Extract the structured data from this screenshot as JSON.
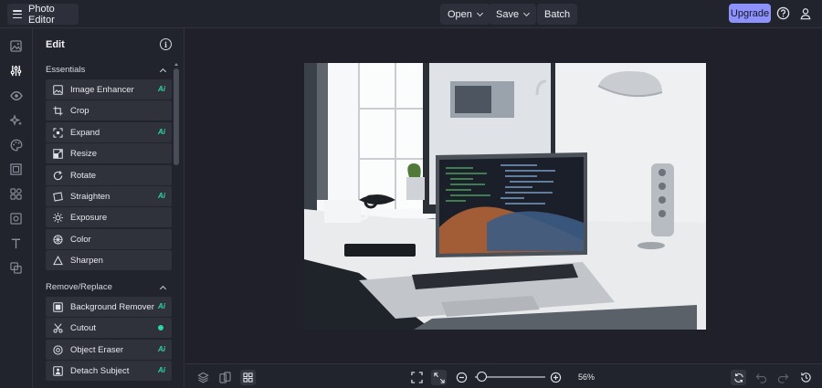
{
  "header": {
    "app_name": "Photo Editor",
    "menus": [
      {
        "label": "Open"
      },
      {
        "label": "Save"
      },
      {
        "label": "Batch"
      }
    ],
    "upgrade_label": "Upgrade",
    "icons": [
      "help-icon",
      "user-icon"
    ]
  },
  "rail": {
    "icons": [
      "image-icon",
      "adjustments-icon",
      "eye-icon",
      "sparkles-icon",
      "palette-icon",
      "frame-icon",
      "shapes-icon",
      "graphics-icon",
      "text-icon",
      "overlay-icon"
    ],
    "active": "adjustments-icon"
  },
  "panel": {
    "title": "Edit",
    "sections": [
      {
        "label": "Essentials",
        "tools": [
          {
            "label": "Image Enhancer",
            "badge": "Ai"
          },
          {
            "label": "Crop",
            "badge": ""
          },
          {
            "label": "Expand",
            "badge": "Ai"
          },
          {
            "label": "Resize",
            "badge": ""
          },
          {
            "label": "Rotate",
            "badge": ""
          },
          {
            "label": "Straighten",
            "badge": "Ai"
          },
          {
            "label": "Exposure",
            "badge": ""
          },
          {
            "label": "Color",
            "badge": ""
          },
          {
            "label": "Sharpen",
            "badge": ""
          }
        ]
      },
      {
        "label": "Remove/Replace",
        "tools": [
          {
            "label": "Background Remover",
            "badge": "Ai"
          },
          {
            "label": "Cutout",
            "badge": "dot"
          },
          {
            "label": "Object Eraser",
            "badge": "Ai"
          },
          {
            "label": "Detach Subject",
            "badge": "Ai"
          }
        ]
      }
    ]
  },
  "bottom": {
    "zoom_label": "56%",
    "zoom_level": 0.05
  },
  "colors": {
    "accent": "#8c92fa",
    "ai_badge": "#2fd6a5",
    "background": "#1f2029",
    "panel": "#22242d"
  }
}
